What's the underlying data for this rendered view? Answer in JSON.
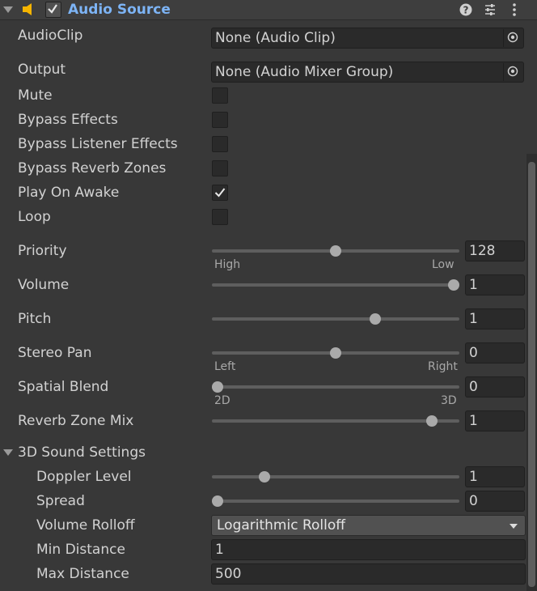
{
  "component": {
    "title": "Audio Source",
    "enabled": true,
    "icons": [
      "speaker-icon",
      "help-icon",
      "preset-icon",
      "more-icon"
    ]
  },
  "fields": {
    "audio_clip": {
      "label": "AudioClip",
      "value": "None (Audio Clip)"
    },
    "output": {
      "label": "Output",
      "value": "None (Audio Mixer Group)"
    },
    "mute": {
      "label": "Mute",
      "checked": false
    },
    "bypass_effects": {
      "label": "Bypass Effects",
      "checked": false
    },
    "bypass_listener_effects": {
      "label": "Bypass Listener Effects",
      "checked": false
    },
    "bypass_reverb_zones": {
      "label": "Bypass Reverb Zones",
      "checked": false
    },
    "play_on_awake": {
      "label": "Play On Awake",
      "checked": true
    },
    "loop": {
      "label": "Loop",
      "checked": false
    },
    "priority": {
      "label": "Priority",
      "value": "128",
      "position": 0.5,
      "left_label": "High",
      "right_label": "Low"
    },
    "volume": {
      "label": "Volume",
      "value": "1",
      "position": 1.0
    },
    "pitch": {
      "label": "Pitch",
      "value": "1",
      "position": 0.667
    },
    "stereo_pan": {
      "label": "Stereo Pan",
      "value": "0",
      "position": 0.5,
      "left_label": "Left",
      "right_label": "Right"
    },
    "spatial_blend": {
      "label": "Spatial Blend",
      "value": "0",
      "position": 0.0,
      "left_label": "2D",
      "right_label": "3D"
    },
    "reverb_zone_mix": {
      "label": "Reverb Zone Mix",
      "value": "1",
      "position": 0.909
    }
  },
  "sound3d": {
    "label": "3D Sound Settings",
    "expanded": true,
    "doppler_level": {
      "label": "Doppler Level",
      "value": "1",
      "position": 0.2
    },
    "spread": {
      "label": "Spread",
      "value": "0",
      "position": 0.0
    },
    "volume_rolloff": {
      "label": "Volume Rolloff",
      "value": "Logarithmic Rolloff"
    },
    "min_distance": {
      "label": "Min Distance",
      "value": "1"
    },
    "max_distance": {
      "label": "Max Distance",
      "value": "500"
    }
  },
  "colors": {
    "title": "#7db4f5",
    "background": "#383838",
    "field": "#2a2a2a",
    "speaker": "#f5b400"
  }
}
